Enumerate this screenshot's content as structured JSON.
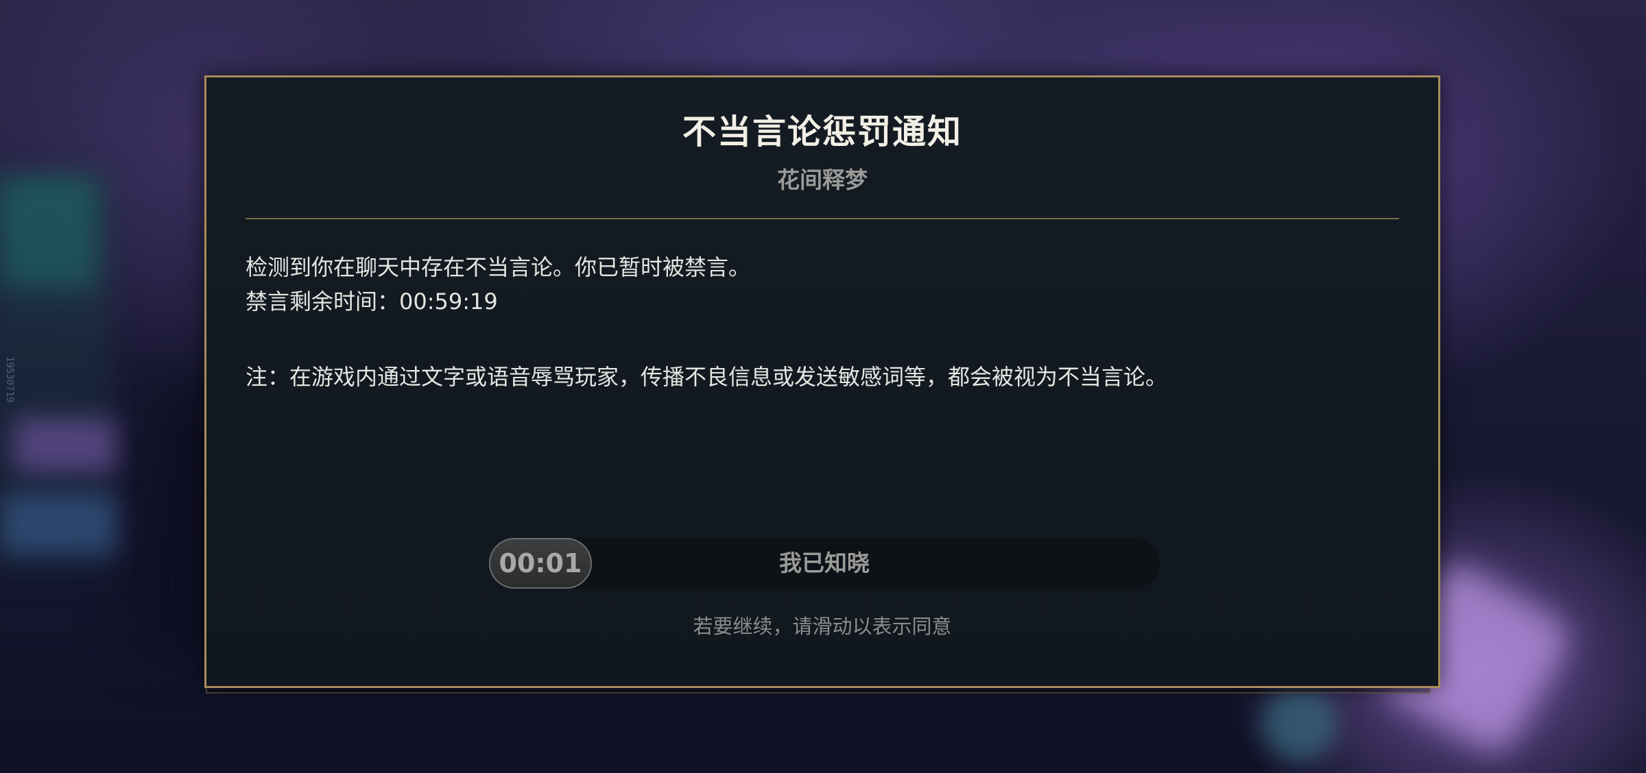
{
  "background": {
    "side_text": "19530719"
  },
  "dialog": {
    "title": "不当言论惩罚通知",
    "subtitle": "花间释梦",
    "message_line1": "检测到你在聊天中存在不当言论。你已暂时被禁言。",
    "message_line2": "禁言剩余时间：00:59:19",
    "note": "注：在游戏内通过文字或语音辱骂玩家，传播不良信息或发送敏感词等，都会被视为不当言论。",
    "slider": {
      "countdown": "00:01",
      "label": "我已知晓",
      "progress": 0
    },
    "hint": "若要继续，请滑动以表示同意"
  },
  "colors": {
    "border_gold": "#a88c5a",
    "panel_bg": "#141b23",
    "title_text": "#f2efe6"
  }
}
